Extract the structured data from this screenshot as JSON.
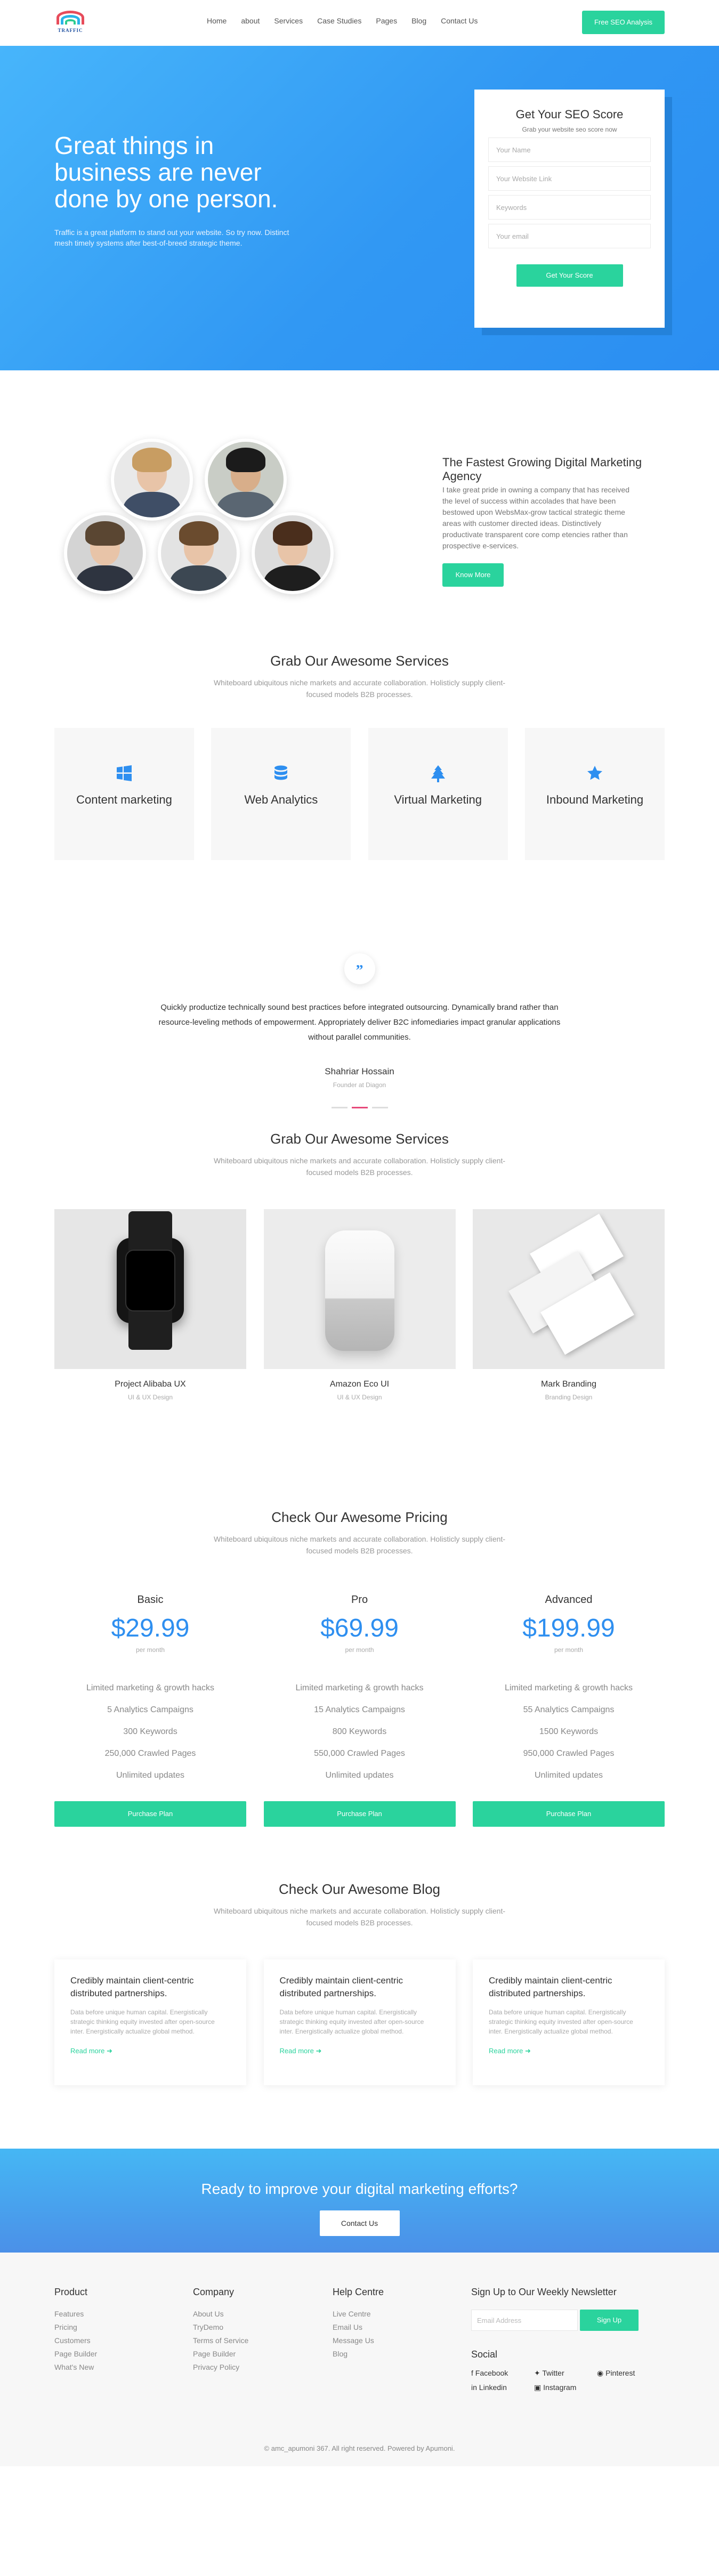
{
  "header": {
    "logo_text": "TRAFFIC",
    "nav": [
      "Home",
      "about",
      "Services",
      "Case Studies",
      "Pages",
      "Blog",
      "Contact Us"
    ],
    "cta": "Free SEO Analysis"
  },
  "hero": {
    "headline": "Great things in business are never done by one person.",
    "text": "Traffic is a great platform to stand out your website. So try now. Distinct mesh timely systems after best-of-breed strategic theme.",
    "form": {
      "title": "Get Your SEO Score",
      "subtitle": "Grab your website seo score now",
      "fields": [
        "Your Name",
        "Your Website Link",
        "Keywords",
        "Your email"
      ],
      "button": "Get Your Score"
    }
  },
  "about": {
    "title": "The Fastest Growing Digital Marketing Agency",
    "text": "I take great pride in owning a company that has received the level of success within accolades that have been bestowed upon WebsMax-grow tactical strategic theme areas with customer directed ideas. Distinctively productivate transparent core comp etencies rather than prospective e-services.",
    "button": "Know More"
  },
  "services": {
    "title": "Grab Our Awesome Services",
    "subtitle": "Whiteboard ubiquitous niche markets and accurate collaboration. Holisticly supply client-focused models B2B processes.",
    "items": [
      {
        "label": "Content marketing",
        "icon": "windows-icon"
      },
      {
        "label": "Web Analytics",
        "icon": "database-icon"
      },
      {
        "label": "Virtual Marketing",
        "icon": "tree-icon"
      },
      {
        "label": "Inbound Marketing",
        "icon": "star-icon"
      }
    ]
  },
  "testimonial": {
    "quote": "Quickly productize technically sound best practices before integrated outsourcing. Dynamically brand rather than resource-leveling methods of empowerment. Appropriately deliver B2C infomediaries impact granular applications without parallel communities.",
    "name": "Shahriar Hossain",
    "role": "Founder at Diagon"
  },
  "portfolio": {
    "title": "Grab Our Awesome Services",
    "subtitle": "Whiteboard ubiquitous niche markets and accurate collaboration. Holisticly supply client-focused models B2B processes.",
    "items": [
      {
        "title": "Project Alibaba UX",
        "tag": "UI & UX Design"
      },
      {
        "title": "Amazon Eco UI",
        "tag": "UI & UX Design"
      },
      {
        "title": "Mark Branding",
        "tag": "Branding Design"
      }
    ]
  },
  "pricing": {
    "title": "Check Our Awesome Pricing",
    "subtitle": "Whiteboard ubiquitous niche markets and accurate collaboration. Holisticly supply client-focused models B2B processes.",
    "plans": [
      {
        "name": "Basic",
        "price": "$29.99",
        "period": "per month",
        "features": [
          "Limited marketing & growth hacks",
          "5 Analytics Campaigns",
          "300 Keywords",
          "250,000 Crawled Pages",
          "Unlimited updates"
        ],
        "button": "Purchase Plan"
      },
      {
        "name": "Pro",
        "price": "$69.99",
        "period": "per month",
        "features": [
          "Limited marketing & growth hacks",
          "15 Analytics Campaigns",
          "800 Keywords",
          "550,000 Crawled Pages",
          "Unlimited updates"
        ],
        "button": "Purchase Plan"
      },
      {
        "name": "Advanced",
        "price": "$199.99",
        "period": "per month",
        "features": [
          "Limited marketing & growth hacks",
          "55 Analytics Campaigns",
          "1500 Keywords",
          "950,000 Crawled Pages",
          "Unlimited updates"
        ],
        "button": "Purchase Plan"
      }
    ]
  },
  "blog": {
    "title": "Check Our Awesome Blog",
    "subtitle": "Whiteboard ubiquitous niche markets and accurate collaboration. Holisticly supply client-focused models B2B processes.",
    "posts": [
      {
        "title": "Credibly maintain client-centric distributed partnerships.",
        "excerpt": "Data before unique human capital. Energistically strategic thinking equity invested after open-source inter. Energistically actualize global method.",
        "link": "Read more"
      },
      {
        "title": "Credibly maintain client-centric distributed partnerships.",
        "excerpt": "Data before unique human capital. Energistically strategic thinking equity invested after open-source inter. Energistically actualize global method.",
        "link": "Read more"
      },
      {
        "title": "Credibly maintain client-centric distributed partnerships.",
        "excerpt": "Data before unique human capital. Energistically strategic thinking equity invested after open-source inter. Energistically actualize global method.",
        "link": "Read more"
      }
    ]
  },
  "cta_banner": {
    "title": "Ready to improve your digital marketing efforts?",
    "button": "Contact Us"
  },
  "footer": {
    "product": {
      "title": "Product",
      "links": [
        "Features",
        "Pricing",
        "Customers",
        "Page Builder",
        "What's New"
      ]
    },
    "company": {
      "title": "Company",
      "links": [
        "About Us",
        "TryDemo",
        "Terms of Service",
        "Page Builder",
        "Privacy Policy"
      ]
    },
    "help": {
      "title": "Help Centre",
      "links": [
        "Live Centre",
        "Email Us",
        "Message Us",
        "Blog"
      ]
    },
    "newsletter": {
      "title": "Sign Up to Our Weekly Newsletter",
      "placeholder": "Email Address",
      "button": "Sign Up"
    },
    "social": {
      "title": "Social",
      "links": [
        "Facebook",
        "Twitter",
        "Pinterest",
        "Linkedin",
        "Instagram"
      ]
    },
    "copyright": "© amc_apumoni 367. All right reserved. Powered by Apumoni."
  },
  "colors": {
    "primary_blue": "#3198f3",
    "accent_green": "#2ad39d",
    "dot_active": "#e7497a"
  }
}
